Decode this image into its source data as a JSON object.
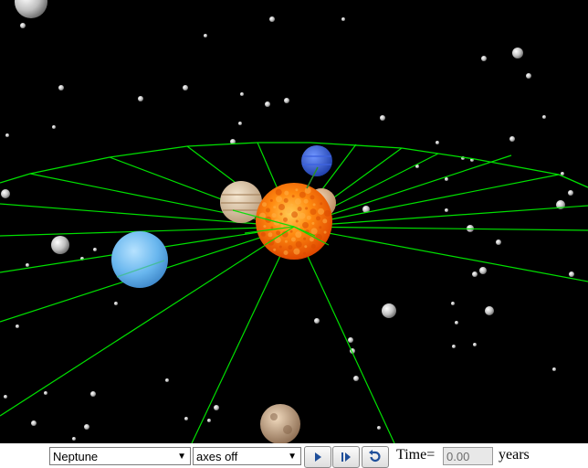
{
  "planet_select": {
    "value": "Neptune"
  },
  "axes_select": {
    "value": "axes off"
  },
  "time": {
    "label": "Time=",
    "value": "0.00",
    "unit": "years"
  },
  "icons": {
    "play": "play-icon",
    "step": "step-forward-icon",
    "reset": "reset-icon"
  },
  "colors": {
    "grid": "#00e000",
    "space": "#000000",
    "sun": "#ff6a00"
  }
}
